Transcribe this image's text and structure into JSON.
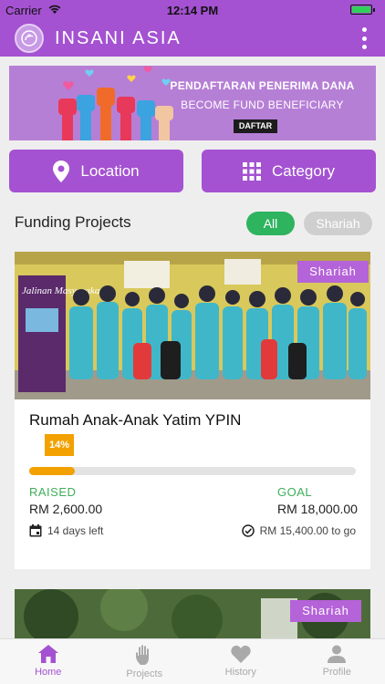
{
  "status_bar": {
    "carrier": "Carrier",
    "time": "12:14 PM"
  },
  "app_bar": {
    "title": "INSANI ASIA"
  },
  "banner": {
    "line1": "PENDAFTARAN PENERIMA DANA",
    "line2": "BECOME FUND BENEFICIARY",
    "button": "DAFTAR"
  },
  "filters": {
    "location_label": "Location",
    "category_label": "Category"
  },
  "section": {
    "title": "Funding Projects",
    "pill_all": "All",
    "pill_shariah": "Shariah"
  },
  "projects": [
    {
      "tag": "Shariah",
      "name": "Rumah Anak-Anak Yatim YPIN",
      "percent_label": "14%",
      "progress": 0.14,
      "raised_label": "RAISED",
      "raised_value": "RM 2,600.00",
      "goal_label": "GOAL",
      "goal_value": "RM 18,000.00",
      "days_left": "14 days left",
      "to_go": "RM 15,400.00 to go",
      "photo_banner_text": "Jalinan Masyarakat"
    },
    {
      "tag": "Shariah"
    }
  ],
  "bottom_nav": [
    {
      "label": "Home",
      "icon": "home-icon",
      "active": true
    },
    {
      "label": "Projects",
      "icon": "hand-icon",
      "active": false
    },
    {
      "label": "History",
      "icon": "heart-icon",
      "active": false
    },
    {
      "label": "Profile",
      "icon": "person-icon",
      "active": false
    }
  ],
  "colors": {
    "brand": "#a452d1",
    "accent_green": "#2eb35f",
    "progress": "#f2a100"
  }
}
